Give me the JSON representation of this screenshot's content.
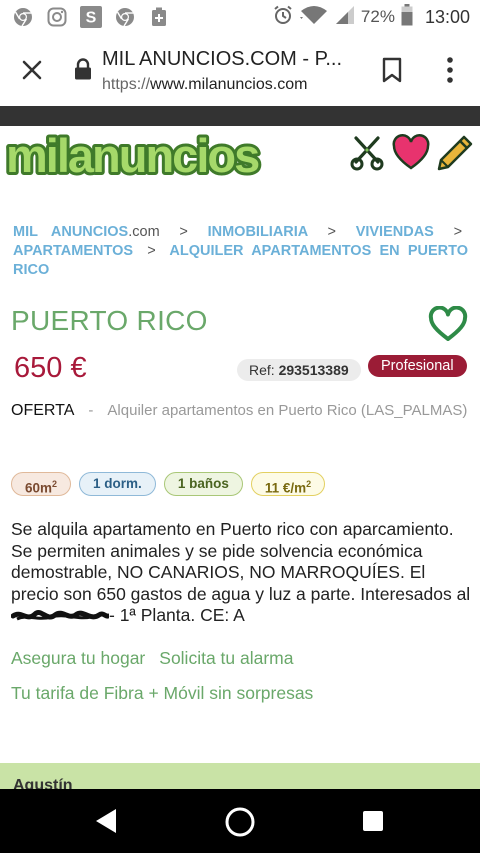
{
  "status_bar": {
    "battery": "72%",
    "time": "13:00",
    "left_icons": [
      "chrome-icon",
      "instagram-icon",
      "s-app-icon",
      "chrome-icon",
      "add-box-icon"
    ],
    "right_icons": [
      "alarm-icon",
      "wifi-icon",
      "signal-icon",
      "battery-icon"
    ]
  },
  "browser": {
    "page_title": "MIL ANUNCIOS.COM - P...",
    "url_scheme": "https://",
    "url_host": "www.milanuncios.com"
  },
  "site": {
    "logo_text": "milanuncios",
    "header_icons": [
      "scissors-icon",
      "heart-icon",
      "pencil-icon"
    ]
  },
  "breadcrumb": {
    "site": "MIL ANUNCIOS",
    "site_suffix": ".com",
    "separator": ">",
    "items": [
      "INMOBILIARIA",
      "VIVIENDAS",
      "APARTAMENTOS",
      "ALQUILER APARTAMENTOS EN PUERTO RICO"
    ]
  },
  "listing": {
    "title": "PUERTO RICO",
    "price": "650 €",
    "ref_label": "Ref:",
    "ref_number": "293513389",
    "seller_type": "Profesional",
    "offer_type": "OFERTA",
    "offer_separator": "-",
    "offer_description": "Alquiler apartamentos en Puerto Rico (LAS_PALMAS)",
    "tags": {
      "area": "60m",
      "area_sup": "2",
      "bedrooms": "1 dorm.",
      "bathrooms": "1 baños",
      "price_per_m2": "11 €/m",
      "price_per_m2_sup": "2"
    },
    "description_before": "Se alquila apartamento en Puerto rico con aparcamiento. Se permiten animales y se pide solvencia económica demostrable, NO CANARIOS, NO MARROQUÍES. El precio son 650 gastos de agua y luz a parte. Interesados al",
    "description_after": "- 1ª Planta. CE: A"
  },
  "links": {
    "home_insurance": "Asegura tu hogar",
    "alarm": "Solicita tu alarma",
    "fiber": "Tu tarifa de Fibra + Móvil sin sorpresas"
  },
  "seller": {
    "name": "Agustín"
  },
  "colors": {
    "brand_green": "#6aa86a",
    "price_red": "#a8193a",
    "profesional_badge": "#9b1c36",
    "breadcrumb_blue": "#6bb0d8",
    "seller_bar": "#c9e3a6"
  }
}
